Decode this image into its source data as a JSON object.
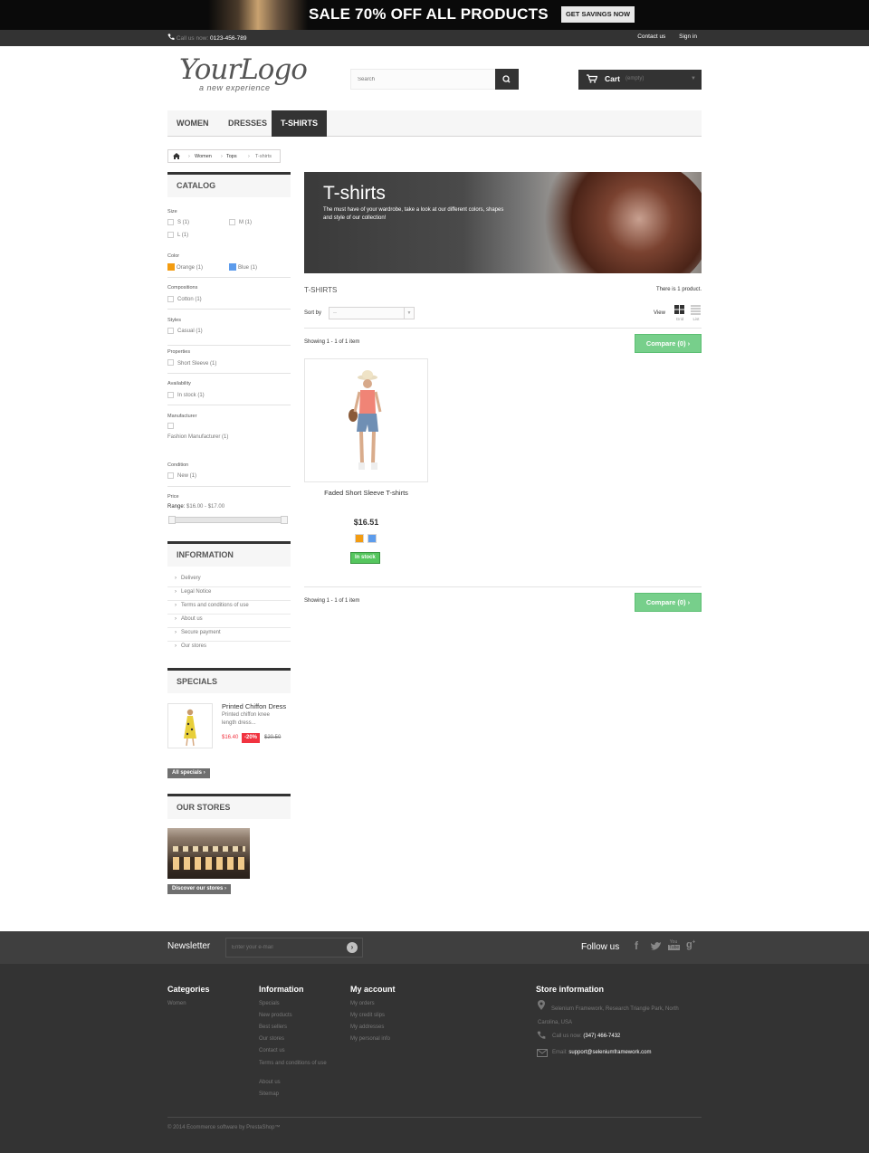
{
  "banner": {
    "sale_text": "SALE 70% OFF ALL PRODUCTS",
    "cta": "GET SAVINGS NOW"
  },
  "topbar": {
    "call_label": "Call us now:",
    "phone": "0123-456-789",
    "contact": "Contact us",
    "signin": "Sign in"
  },
  "logo": {
    "main": "YourLogo",
    "tagline": "a new experience"
  },
  "search": {
    "placeholder": "Search"
  },
  "cart": {
    "label": "Cart",
    "status": "(empty)"
  },
  "menu": [
    "WOMEN",
    "DRESSES",
    "T-SHIRTS"
  ],
  "breadcrumb": [
    "Women",
    "Tops",
    "T-shirts"
  ],
  "catalog": {
    "title": "CATALOG",
    "filters": [
      {
        "label": "Size",
        "values": [
          "S (1)",
          "M (1)",
          "L (1)"
        ]
      },
      {
        "label": "Color",
        "values": [
          "Orange (1)",
          "Blue (1)"
        ],
        "colors": [
          "#f39c11",
          "#5d9cec"
        ]
      },
      {
        "label": "Compositions",
        "values": [
          "Cotton (1)"
        ]
      },
      {
        "label": "Styles",
        "values": [
          "Casual (1)"
        ]
      },
      {
        "label": "Properties",
        "values": [
          "Short Sleeve (1)"
        ]
      },
      {
        "label": "Availability",
        "values": [
          "In stock (1)"
        ]
      },
      {
        "label": "Manufacturer",
        "values": [
          "Fashion Manufacturer (1)"
        ]
      },
      {
        "label": "Condition",
        "values": [
          "New (1)"
        ]
      }
    ],
    "price": {
      "label": "Price",
      "range_label": "Range:",
      "range": "$16.00 - $17.00"
    }
  },
  "information": {
    "title": "INFORMATION",
    "items": [
      "Delivery",
      "Legal Notice",
      "Terms and conditions of use",
      "About us",
      "Secure payment",
      "Our stores"
    ]
  },
  "specials": {
    "title": "SPECIALS",
    "product": {
      "name": "Printed Chiffon Dress",
      "desc": "Printed chiffon knee length dress...",
      "price": "$16.40",
      "discount": "-20%",
      "old_price": "$20.50"
    },
    "all_button": "All specials"
  },
  "stores": {
    "title": "OUR STORES",
    "button": "Discover our stores"
  },
  "category": {
    "title": "T-shirts",
    "description": "The must have of your wardrobe, take a look at our different colors, shapes and style of our collection!"
  },
  "listing": {
    "heading": "T-SHIRTS",
    "count": "There is 1 product.",
    "sortby": "Sort by",
    "sort_value": "--",
    "view": "View",
    "grid": "Grid",
    "list": "List",
    "showing": "Showing 1 - 1 of 1 item",
    "compare": "Compare (0)"
  },
  "product": {
    "name": "Faded Short Sleeve T-shirts",
    "price": "$16.51",
    "stock": "In stock",
    "colors": [
      "#f39c11",
      "#5d9cec"
    ]
  },
  "newsletter": {
    "title": "Newsletter",
    "placeholder": "Enter your e-mail",
    "follow": "Follow us"
  },
  "footer": {
    "categories": {
      "title": "Categories",
      "items": [
        "Women"
      ]
    },
    "information": {
      "title": "Information",
      "items": [
        "Specials",
        "New products",
        "Best sellers",
        "Our stores",
        "Contact us",
        "Terms and conditions of use",
        "About us",
        "Sitemap"
      ]
    },
    "account": {
      "title": "My account",
      "items": [
        "My orders",
        "My credit slips",
        "My addresses",
        "My personal info"
      ]
    },
    "store": {
      "title": "Store information",
      "address": "Selenium Framework, Research Triangle Park, North Carolina, USA",
      "call_label": "Call us now:",
      "phone": "(347) 466-7432",
      "email_label": "Email:",
      "email": "support@seleniumframework.com"
    },
    "copyright": "© 2014 Ecommerce software by PrestaShop™"
  }
}
